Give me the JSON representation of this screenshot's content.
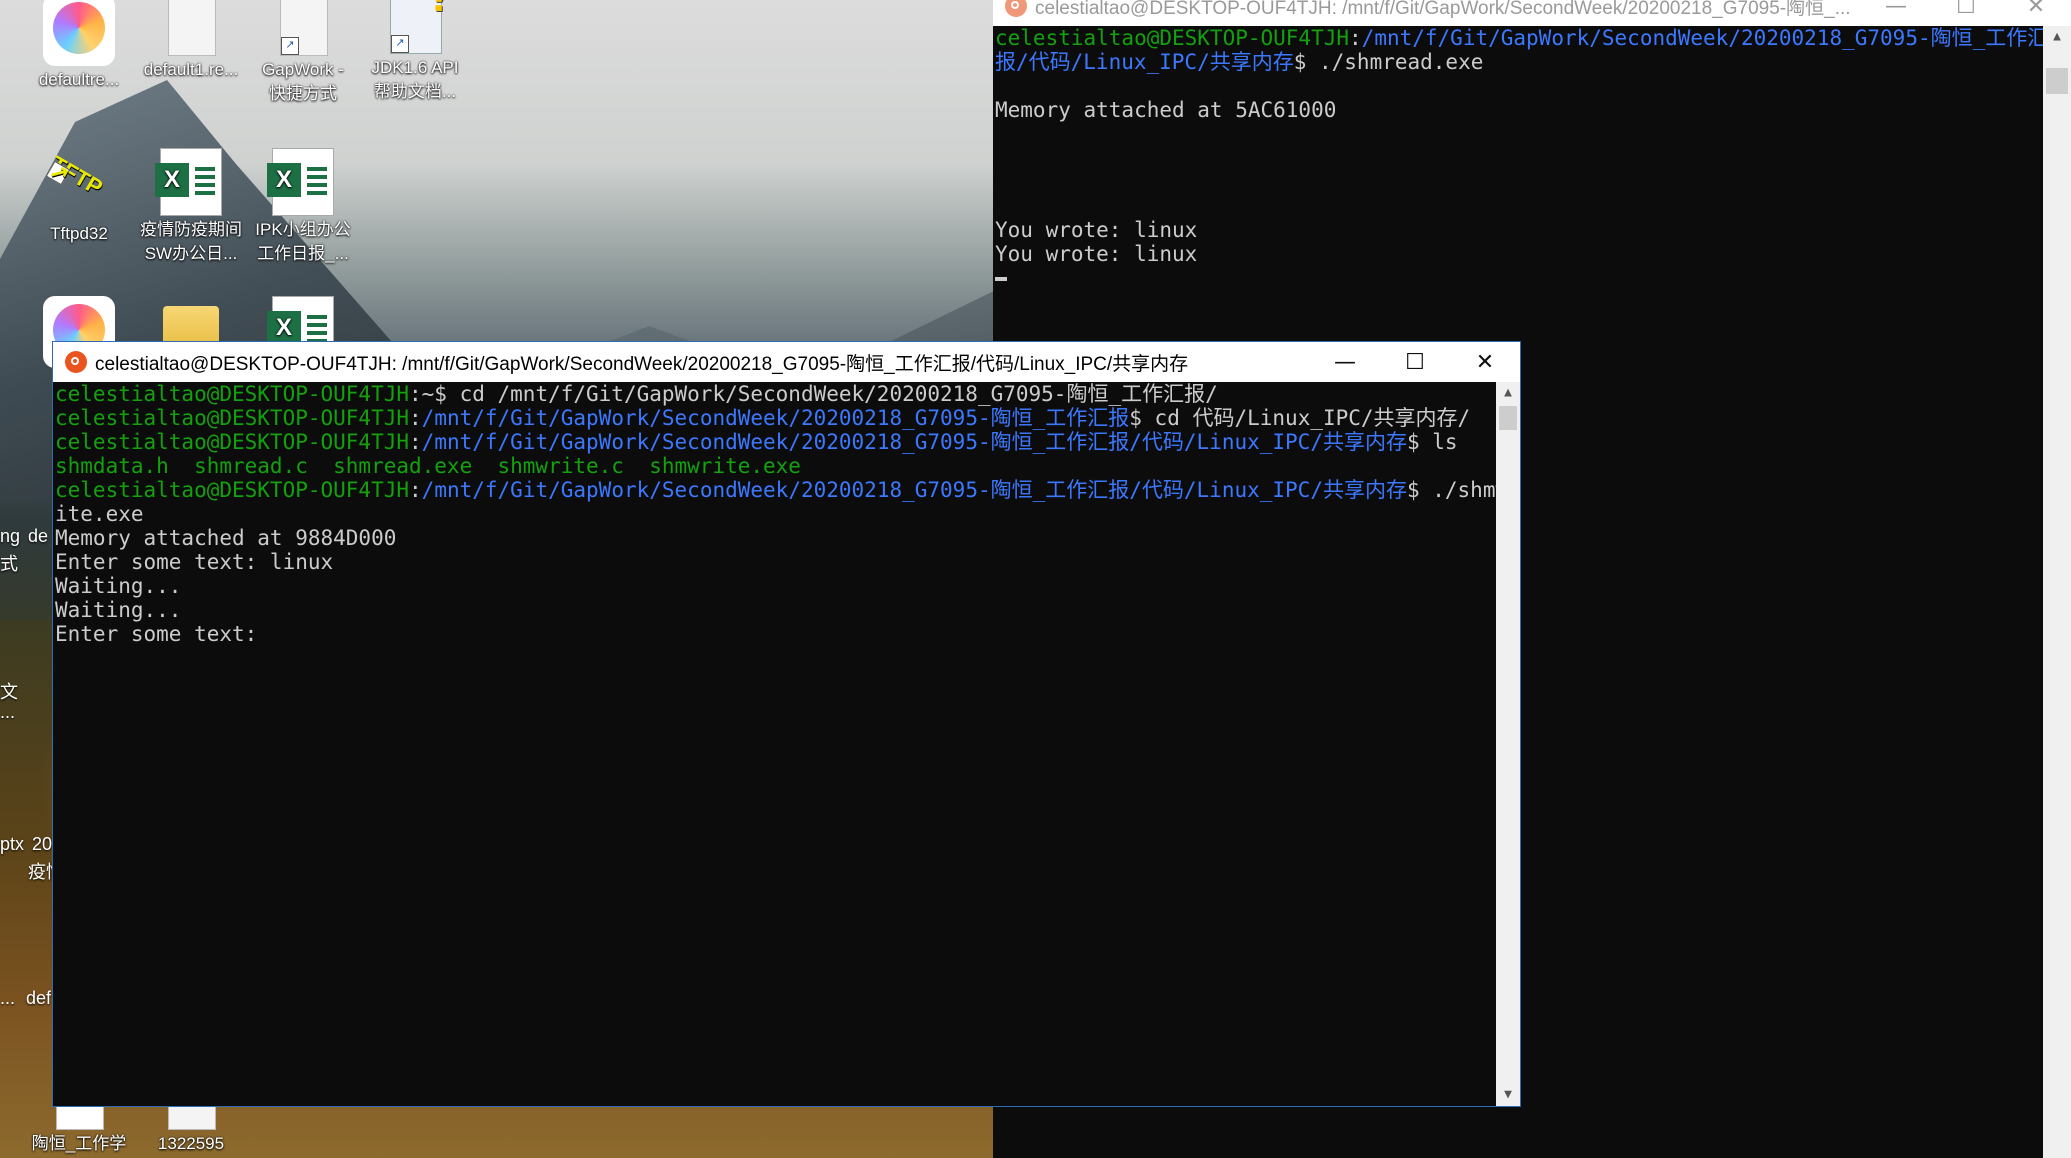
{
  "desktop": {
    "icons": [
      {
        "label": "defaultre...",
        "label2": "",
        "kind": "sphere-icon"
      },
      {
        "label": "default1.re...",
        "label2": "",
        "kind": "document-icon"
      },
      {
        "label": "GapWork -",
        "label2": "快捷方式",
        "kind": "document-icon"
      },
      {
        "label": "JDK1.6 API",
        "label2": "帮助文档...",
        "kind": "help-document-icon"
      },
      {
        "label": "Tftpd32",
        "label2": "",
        "kind": "tftp-icon"
      },
      {
        "label": "疫情防疫期间",
        "label2": "SW办公日...",
        "kind": "excel-icon"
      },
      {
        "label": "IPK小组办公",
        "label2": "工作日报_...",
        "kind": "excel-icon"
      },
      {
        "label": "陶恒_工作学",
        "label2": "",
        "kind": "document-icon"
      },
      {
        "label": "1322595",
        "label2": "",
        "kind": "document-icon"
      }
    ],
    "edge_labels": [
      "ng",
      "de",
      "式",
      "文",
      "...",
      "ptx",
      "20",
      "疫情",
      "...",
      "def"
    ]
  },
  "back_terminal": {
    "title": "celestialtao@DESKTOP-OUF4TJH: /mnt/f/Git/GapWork/SecondWeek/20200218_G7095-陶恒_...",
    "prompt_user": "celestialtao@DESKTOP-OUF4TJH",
    "prompt_sep": ":",
    "path_line1": "/mnt/f/Git/GapWork/SecondWeek/20200218_G7095-陶恒_工作汇",
    "path_line2": "报/代码/Linux_IPC/共享内存",
    "command": "$ ./shmread.exe",
    "out1": "Memory attached at 5AC61000",
    "out2": "You wrote: linux",
    "out3": "You wrote: linux"
  },
  "front_terminal": {
    "title": "celestialtao@DESKTOP-OUF4TJH: /mnt/f/Git/GapWork/SecondWeek/20200218_G7095-陶恒_工作汇报/代码/Linux_IPC/共享内存",
    "l1_user": "celestialtao@DESKTOP-OUF4TJH",
    "l1_rest": ":~$ cd /mnt/f/Git/GapWork/SecondWeek/20200218_G7095-陶恒_工作汇报/",
    "l2_user": "celestialtao@DESKTOP-OUF4TJH",
    "l2_sep": ":",
    "l2_path": "/mnt/f/Git/GapWork/SecondWeek/20200218_G7095-陶恒_工作汇报",
    "l2_cmd": "$ cd 代码/Linux_IPC/共享内存/",
    "l3_user": "celestialtao@DESKTOP-OUF4TJH",
    "l3_sep": ":",
    "l3_path": "/mnt/f/Git/GapWork/SecondWeek/20200218_G7095-陶恒_工作汇报/代码/Linux_IPC/共享内存",
    "l3_cmd": "$ ls",
    "ls_output": "shmdata.h  shmread.c  shmread.exe  shmwrite.c  shmwrite.exe",
    "l5_user": "celestialtao@DESKTOP-OUF4TJH",
    "l5_sep": ":",
    "l5_path": "/mnt/f/Git/GapWork/SecondWeek/20200218_G7095-陶恒_工作汇报/代码/Linux_IPC/共享内存",
    "l5_cmd": "$ ./shmwr",
    "l6": "ite.exe",
    "l7": "Memory attached at 9884D000",
    "l8": "Enter some text: linux",
    "l9": "Waiting...",
    "l10": "Waiting...",
    "l11": "Enter some text:"
  },
  "colors": {
    "prompt_user": "#13a10e",
    "prompt_path": "#3b78ff",
    "terminal_bg": "#0c0c0c",
    "terminal_text": "#cccccc",
    "ubuntu_orange": "#e95420"
  }
}
